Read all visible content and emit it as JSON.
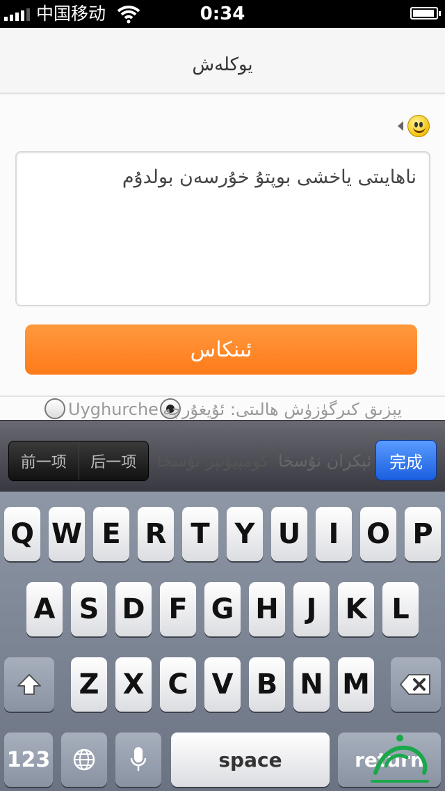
{
  "status_bar": {
    "carrier": "中国移动",
    "time": "0:34"
  },
  "nav": {
    "title": "يوكلەش"
  },
  "compose": {
    "text": "ناھايىتى ياخشى بوپتۇ  خۇرسەن بولدۇم",
    "submit_label": "ئىنكاس"
  },
  "input_mode": {
    "label": "يېزىق كىرگۈزۈش ھالىتى: ئۇيغۇرچە",
    "options": [
      "ئۇيغۇرچە",
      "Uyghurche"
    ],
    "selected": "ئۇيغۇرچە"
  },
  "keyboard_toolbar": {
    "prev_label": "前一项",
    "next_label": "后一项",
    "option_computer": "كومپيۇتېر نۇسخا",
    "option_phone": "ئېكران نۇسخا",
    "done_label": "完成"
  },
  "keyboard": {
    "row1": [
      "Q",
      "W",
      "E",
      "R",
      "T",
      "Y",
      "U",
      "I",
      "O",
      "P"
    ],
    "row2": [
      "A",
      "S",
      "D",
      "F",
      "G",
      "H",
      "J",
      "K",
      "L"
    ],
    "row3": [
      "Z",
      "X",
      "C",
      "V",
      "B",
      "N",
      "M"
    ],
    "numbers_label": "123",
    "space_label": "space",
    "return_label": "return"
  },
  "colors": {
    "accent": "#ff8a2a",
    "done_blue": "#2a6ff0"
  },
  "icons": [
    "signal-icon",
    "wifi-icon",
    "battery-icon",
    "emoji-icon",
    "shift-icon",
    "backspace-icon",
    "globe-icon",
    "microphone-icon"
  ]
}
